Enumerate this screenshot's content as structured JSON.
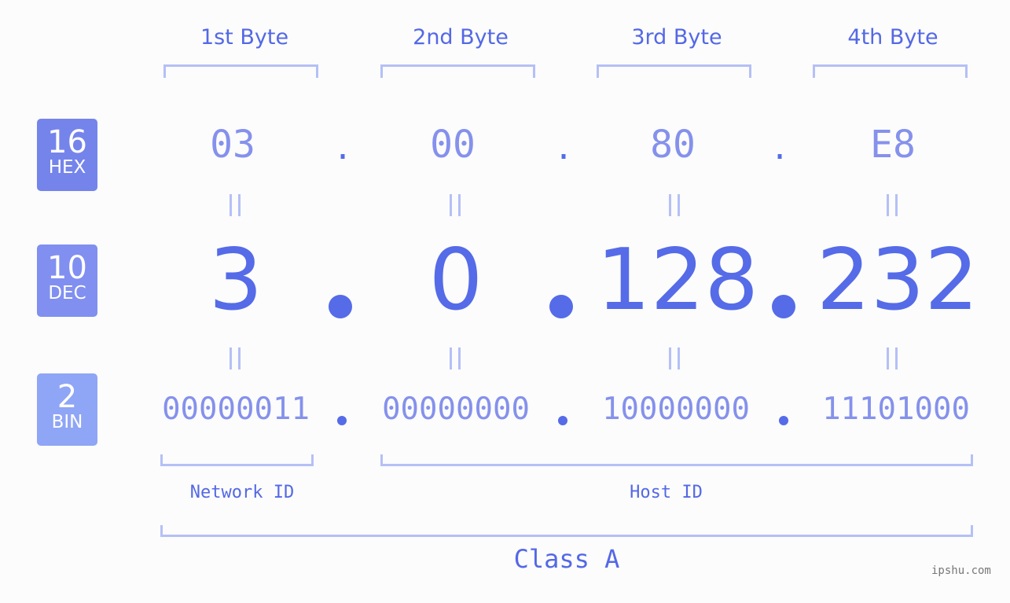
{
  "bytes": {
    "headers": [
      "1st Byte",
      "2nd Byte",
      "3rd Byte",
      "4th Byte"
    ]
  },
  "badges": {
    "hex": {
      "number": "16",
      "label": "HEX",
      "color": "#7584eb"
    },
    "dec": {
      "number": "10",
      "label": "DEC",
      "color": "#808ff0"
    },
    "bin": {
      "number": "2",
      "label": "BIN",
      "color": "#8fa5f5"
    }
  },
  "ip": {
    "hex": [
      "03",
      "00",
      "80",
      "E8"
    ],
    "dec": [
      "3",
      "0",
      "128",
      "232"
    ],
    "bin": [
      "00000011",
      "00000000",
      "10000000",
      "11101000"
    ],
    "separator": "."
  },
  "segments": {
    "network_id": "Network ID",
    "host_id": "Host ID",
    "class": "Class A"
  },
  "watermark": "ipshu.com",
  "colors": {
    "accent": "#556be8",
    "light": "#8591ec",
    "bracket": "#b5c0f6",
    "background": "#fbfcfb"
  }
}
